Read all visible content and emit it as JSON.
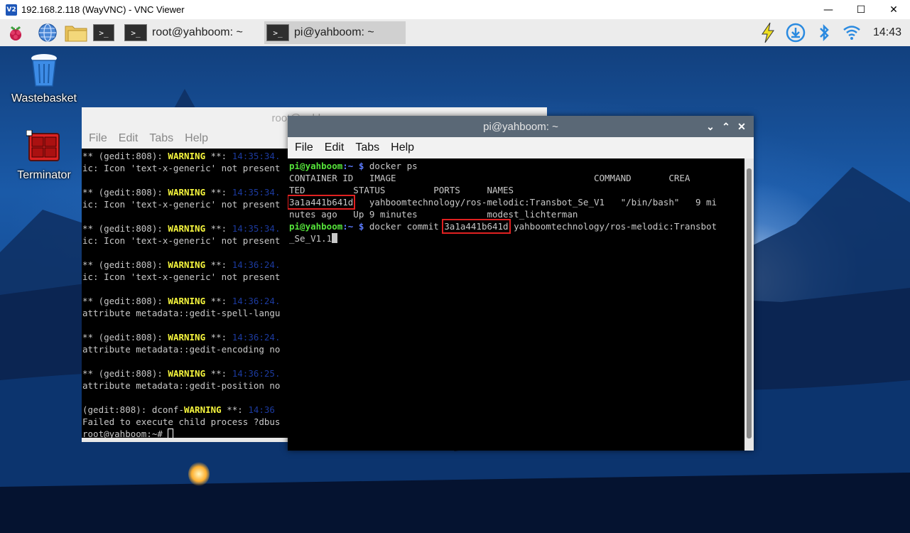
{
  "vnc": {
    "logo": "V2",
    "title": "192.168.2.118 (WayVNC) - VNC Viewer",
    "minimize": "—",
    "maximize": "☐",
    "close": "✕"
  },
  "panel": {
    "tasks": [
      {
        "label": "root@yahboom: ~",
        "icon": "terminal-icon"
      },
      {
        "label": "pi@yahboom: ~",
        "icon": "terminal-icon",
        "active": true
      }
    ],
    "clock": "14:43",
    "tray_icons": [
      "power-icon",
      "download-icon",
      "bluetooth-icon",
      "wifi-icon"
    ],
    "launcher_icons": [
      "raspberry-menu-icon",
      "browser-globe-icon",
      "file-manager-icon",
      "terminal-icon"
    ]
  },
  "desktop": {
    "icons": [
      {
        "label": "Wastebasket",
        "icon": "wastebasket-icon"
      },
      {
        "label": "Terminator",
        "icon": "terminator-icon"
      }
    ]
  },
  "back_terminal": {
    "title": "root@yahboom: ~",
    "menu": [
      "File",
      "Edit",
      "Tabs",
      "Help"
    ],
    "lines": [
      {
        "a": "** (gedit:808): ",
        "w": "WARNING",
        "b": " **: ",
        "t": "14:35:34.",
        "rest": ""
      },
      {
        "plain": "ic: Icon 'text-x-generic' not present"
      },
      {
        "plain": ""
      },
      {
        "a": "** (gedit:808): ",
        "w": "WARNING",
        "b": " **: ",
        "t": "14:35:34.",
        "rest": ""
      },
      {
        "plain": "ic: Icon 'text-x-generic' not present"
      },
      {
        "plain": ""
      },
      {
        "a": "** (gedit:808): ",
        "w": "WARNING",
        "b": " **: ",
        "t": "14:35:34.",
        "rest": ""
      },
      {
        "plain": "ic: Icon 'text-x-generic' not present"
      },
      {
        "plain": ""
      },
      {
        "a": "** (gedit:808): ",
        "w": "WARNING",
        "b": " **: ",
        "t": "14:36:24.",
        "rest": ""
      },
      {
        "plain": "ic: Icon 'text-x-generic' not present"
      },
      {
        "plain": ""
      },
      {
        "a": "** (gedit:808): ",
        "w": "WARNING",
        "b": " **: ",
        "t": "14:36:24.",
        "rest": ""
      },
      {
        "plain": "attribute metadata::gedit-spell-langu"
      },
      {
        "plain": ""
      },
      {
        "a": "** (gedit:808): ",
        "w": "WARNING",
        "b": " **: ",
        "t": "14:36:24.",
        "rest": ""
      },
      {
        "plain": "attribute metadata::gedit-encoding no"
      },
      {
        "plain": ""
      },
      {
        "a": "** (gedit:808): ",
        "w": "WARNING",
        "b": " **: ",
        "t": "14:36:25.",
        "rest": ""
      },
      {
        "plain": "attribute metadata::gedit-position no"
      },
      {
        "plain": ""
      },
      {
        "a": "(gedit:808): dconf-",
        "w": "WARNING",
        "b": " **: ",
        "t": "14:36",
        "rest": ""
      },
      {
        "plain": "Failed to execute child process ?dbus"
      },
      {
        "prompt": "root@yahboom:~# "
      }
    ]
  },
  "front_terminal": {
    "title": "pi@yahboom: ~",
    "menu": [
      "File",
      "Edit",
      "Tabs",
      "Help"
    ],
    "ctrl_min": "⌄",
    "ctrl_max": "⌃",
    "ctrl_close": "✕",
    "prompt_user": "pi@yahboom",
    "prompt_path": ":~ $ ",
    "cmd1": "docker ps",
    "header_line1": "CONTAINER ID   IMAGE                                     COMMAND       CREA",
    "header_line2": "TED         STATUS         PORTS     NAMES",
    "container_id": "3a1a441b641d",
    "row_line1_rest": "   yahboomtechnology/ros-melodic:Transbot_Se_V1   \"/bin/bash\"   9 mi",
    "row_line2": "nutes ago   Up 9 minutes             modest_lichterman",
    "cmd2_prefix": "docker commit ",
    "cmd2_id": "3a1a441b641d",
    "cmd2_rest": " yahboomtechnology/ros-melodic:Transbot",
    "cmd2_wrap": "_Se_V1.1"
  },
  "colors": {
    "prompt_green": "#55e33a",
    "prompt_blue": "#5c7cff",
    "warning_yellow": "#f5f53d",
    "highlight_red": "#e02020",
    "titlebar_active": "#5a6876"
  }
}
